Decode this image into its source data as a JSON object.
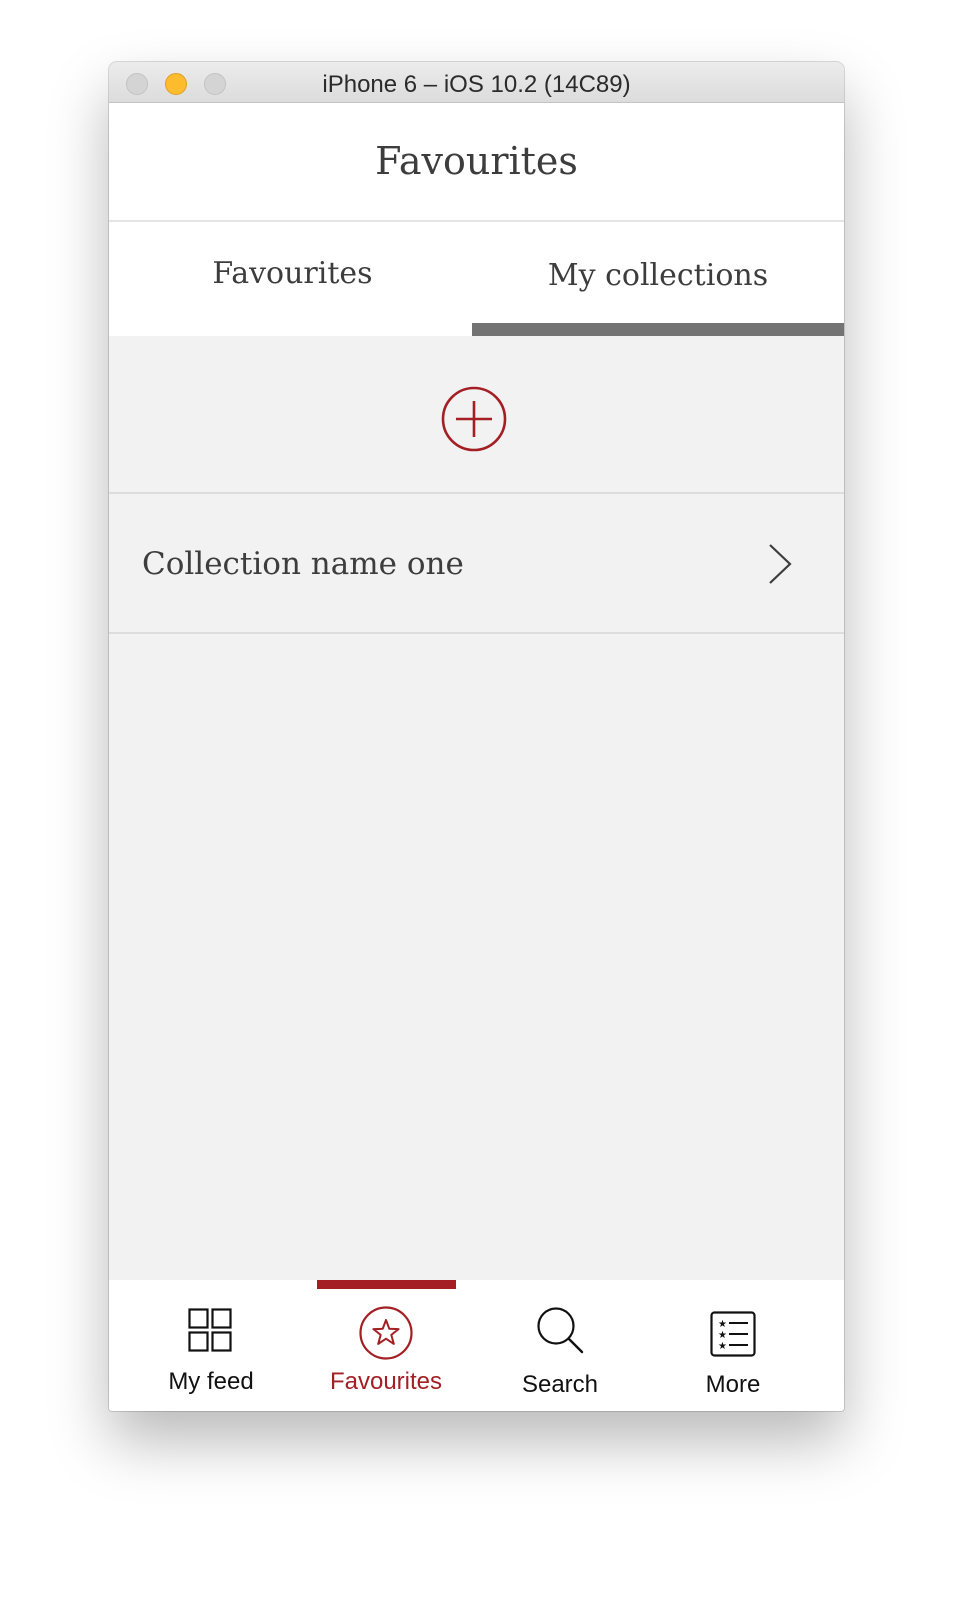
{
  "window": {
    "title": "iPhone 6 – iOS 10.2 (14C89)"
  },
  "navbar": {
    "title": "Favourites"
  },
  "segments": {
    "items": [
      {
        "label": "Favourites",
        "selected": false
      },
      {
        "label": "My collections",
        "selected": true
      }
    ]
  },
  "add_button": {
    "icon": "plus-circle-icon"
  },
  "collections": [
    {
      "name": "Collection name one",
      "icon": "chevron-right-icon"
    }
  ],
  "tabbar": {
    "items": [
      {
        "label": "My feed",
        "icon": "grid-icon",
        "active": false
      },
      {
        "label": "Favourites",
        "icon": "star-circle-icon",
        "active": true
      },
      {
        "label": "Search",
        "icon": "search-icon",
        "active": false
      },
      {
        "label": "More",
        "icon": "list-icon",
        "active": false
      }
    ]
  },
  "colors": {
    "accent": "#a31f24",
    "background": "#f2f2f2",
    "text": "#3d3d3d",
    "tab_indicator": "#737373"
  }
}
